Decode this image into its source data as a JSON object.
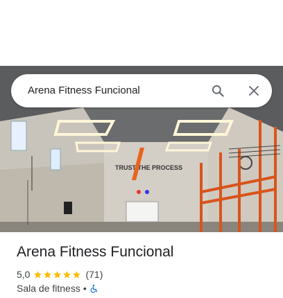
{
  "search": {
    "query": "Arena Fitness Funcional"
  },
  "photo": {
    "wall_sign": "TRUST THE PROCESS"
  },
  "place": {
    "name": "Arena Fitness Funcional",
    "rating": "5,0",
    "stars": 5,
    "review_count": "(71)",
    "category": "Sala de fitness",
    "separator": "•",
    "accessibility_icon": "wheelchair-icon"
  },
  "colors": {
    "star": "#fbbc04",
    "accessibility": "#1a73e8"
  }
}
